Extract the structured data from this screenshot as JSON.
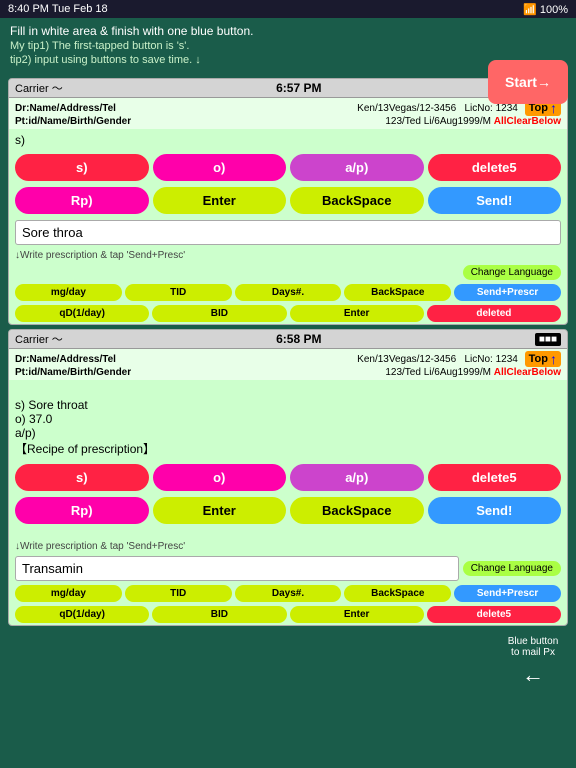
{
  "statusBar": {
    "time": "8:40 PM  Tue Feb 18",
    "signal": "WiFi 100%",
    "battery": "100%"
  },
  "instructions": {
    "line1": "Fill in white area & finish with one blue button.",
    "line2": "My tip1) The first-tapped button is 's'.",
    "line3": "tip2) input using buttons to save time. ↓"
  },
  "startButton": {
    "label": "Start→"
  },
  "panel1": {
    "carrier": "Carrier",
    "time": "6:57 PM",
    "drLabel": "Dr:Name/Address/Tel",
    "drValue": "Ken/13Vegas/12-3456",
    "licLabel": "LicNo:",
    "licValue": "1234",
    "topLabel": "Top",
    "allClear": "AllClearBelow",
    "ptLabel": "Pt:id/Name/Birth/Gender",
    "ptValue": "123/Ted Li/6Aug1999/M",
    "content": "s)",
    "buttons1": {
      "s": "s)",
      "o": "o)",
      "ap": "a/p)",
      "delete5": "delete5"
    },
    "buttons2": {
      "rp": "Rp)",
      "enter": "Enter",
      "backspace": "BackSpace",
      "send": "Send!"
    },
    "textInput": "Sore throa",
    "prescLabel": "↓Write prescription & tap 'Send+Presc'",
    "changeLang": "Change Language",
    "prescRow1": {
      "mgday": "mg/day",
      "tid": "TID",
      "daysh": "Days#.",
      "backspace": "BackSpace",
      "sendPresc": "Send+Prescr"
    },
    "prescRow2": {
      "qd": "qD(1/day)",
      "bid": "BID",
      "enter": "Enter",
      "deleted": "deleted"
    }
  },
  "panel2": {
    "carrier": "Carrier",
    "time": "6:58 PM",
    "drLabel": "Dr:Name/Address/Tel",
    "drValue": "Ken/13Vegas/12-3456",
    "licLabel": "LicNo:",
    "licValue": "1234",
    "topLabel": "Top",
    "allClear": "AllClearBelow",
    "ptLabel": "Pt:id/Name/Birth/Gender",
    "ptValue": "123/Ted Li/6Aug1999/M",
    "content": "s) Sore throat\no) 37.0\na/p)\n【Recipe of prescription】",
    "buttons1": {
      "s": "s)",
      "o": "o)",
      "ap": "a/p)",
      "delete5": "delete5"
    },
    "buttons2": {
      "rp": "Rp)",
      "enter": "Enter",
      "backspace": "BackSpace",
      "send": "Send!"
    },
    "textInput": "Transamin",
    "prescLabel": "↓Write prescription & tap 'Send+Presc'",
    "changeLang": "Change Language",
    "prescRow1": {
      "mgday": "mg/day",
      "tid": "TID",
      "daysh": "Days#.",
      "backspace": "BackSpace",
      "sendPresc": "Send+Prescr"
    },
    "prescRow2": {
      "qd": "qD(1/day)",
      "bid": "BID",
      "enter": "Enter",
      "deleted": "delete5"
    }
  },
  "blueButtonInfo": {
    "label": "Blue button\nto mail Px"
  }
}
